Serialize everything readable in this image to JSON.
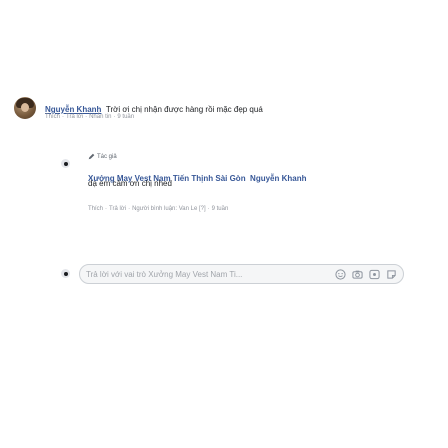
{
  "comment": {
    "author": "Nguyễn Khanh",
    "text": "Trời ơi chị nhận được hàng rồi mặc đẹp quá",
    "actions": {
      "like": "Thích",
      "reply": "Trả lời",
      "message": "Nhắn tin",
      "time": "9 tuần"
    }
  },
  "reply": {
    "badge": "Tác giả",
    "page_name": "Xưởng May Vest Nam Tiến Thịnh Sài Gòn",
    "mention": "Nguyễn Khanh",
    "text": "dạ em cảm ơn chị nhed",
    "actions": {
      "like": "Thích",
      "reply": "Trả lời",
      "commenter": "Người bình luận: Van Le",
      "marker": "[?]",
      "time": "9 tuần"
    }
  },
  "reply_box": {
    "placeholder": "Trả lời với vai trò Xưởng May Vest Nam Ti..."
  },
  "icons": [
    "emoji-icon",
    "camera-icon",
    "gif-icon",
    "sticker-icon"
  ]
}
